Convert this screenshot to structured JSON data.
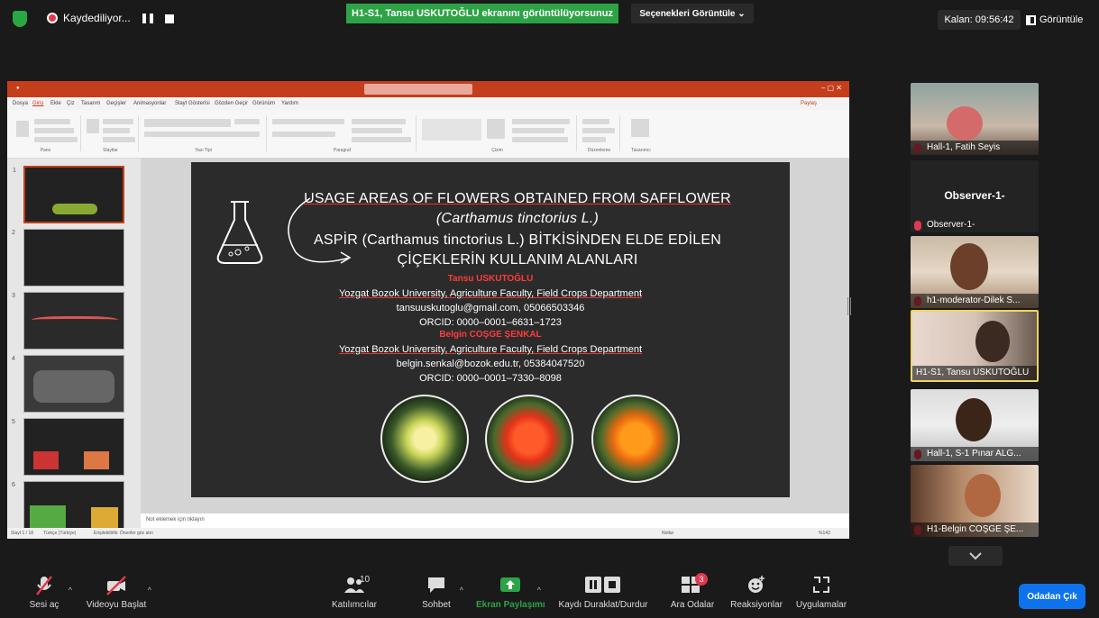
{
  "topbar": {
    "recording": "Kaydediliyor...",
    "share_banner": "H1-S1, Tansu USKUTOĞLU ekranını görüntülüyorsunuz",
    "view_options": "Seçenekleri Görüntüle ⌄",
    "remaining": "Kalan: 09:56:42",
    "view": "Görüntüle"
  },
  "powerpoint": {
    "menu": [
      "Dosya",
      "Giriş",
      "Ekle",
      "Çiz",
      "Tasarım",
      "Geçişler",
      "Animasyonlar",
      "Slayt Gösterisi",
      "Gözden Geçir",
      "Görünüm",
      "Yardım"
    ],
    "groups": [
      "Pano",
      "Slaytlar",
      "Yazı Tipi",
      "Paragraf",
      "Çizim",
      "Düzenleme",
      "Tasarımcı"
    ],
    "share": "Paylaş",
    "notes_placeholder": "Not eklemek için tıklayın",
    "status_left": "Slayt 1 / 18",
    "status_lang": "Türkçe (Türkiye)",
    "status_access": "Erişilebilirlik: Öneriler göz atın",
    "status_notes": "Notlar",
    "zoom": "%143",
    "thumb_numbers": [
      "1",
      "2",
      "3",
      "4",
      "5",
      "6"
    ]
  },
  "slide": {
    "title_en": "USAGE AREAS OF FLOWERS OBTAINED FROM SAFFLOWER",
    "latin_en": "(Carthamus tinctorius L.)",
    "title_tr_a": "ASPİR (Carthamus tinctorius L.) BİTKİSİNDEN ELDE EDİLEN",
    "title_tr_b": "ÇİÇEKLERİN KULLANIM ALANLARI",
    "author1": "Tansu USKUTOĞLU",
    "affil1": "Yozgat Bozok University, Agriculture Faculty, Field Crops Department",
    "contact1": "tansuuskutoglu@gmail.com, 05066503346",
    "orcid1": "ORCID: 0000–0001–6631–1723",
    "author2": "Belgin COŞGE ŞENKAL",
    "affil2": "Yozgat Bozok University, Agriculture Faculty, Field Crops Department",
    "contact2": "belgin.senkal@bozok.edu.tr, 05384047520",
    "orcid2": "ORCID: 0000–0001–7330–8098"
  },
  "participants": [
    {
      "name": "Hall-1, Fatih Seyis"
    },
    {
      "name": "Observer-1-",
      "title": "Observer-1-"
    },
    {
      "name": "h1-moderator-Dilek S..."
    },
    {
      "name": "H1-S1, Tansu USKUTOĞLU"
    },
    {
      "name": "Hall-1, S-1 Pınar ALG..."
    },
    {
      "name": "H1-Belgin COŞGE ŞE..."
    }
  ],
  "toolbar": {
    "mute": "Sesi aç",
    "video": "Videoyu Başlat",
    "participants": "Katılımcılar",
    "participants_count": "10",
    "chat": "Sohbet",
    "share": "Ekran Paylaşımı",
    "pause": "Kaydı Duraklat/Durdur",
    "rooms": "Ara Odalar",
    "rooms_badge": "3",
    "reactions": "Reaksiyonlar",
    "apps": "Uygulamalar",
    "leave": "Odadan Çık"
  },
  "colors": {
    "share_green": "#2da346",
    "pp_red": "#c43e1c",
    "leave_blue": "#0e72ed",
    "active_border": "#f0d55d"
  }
}
